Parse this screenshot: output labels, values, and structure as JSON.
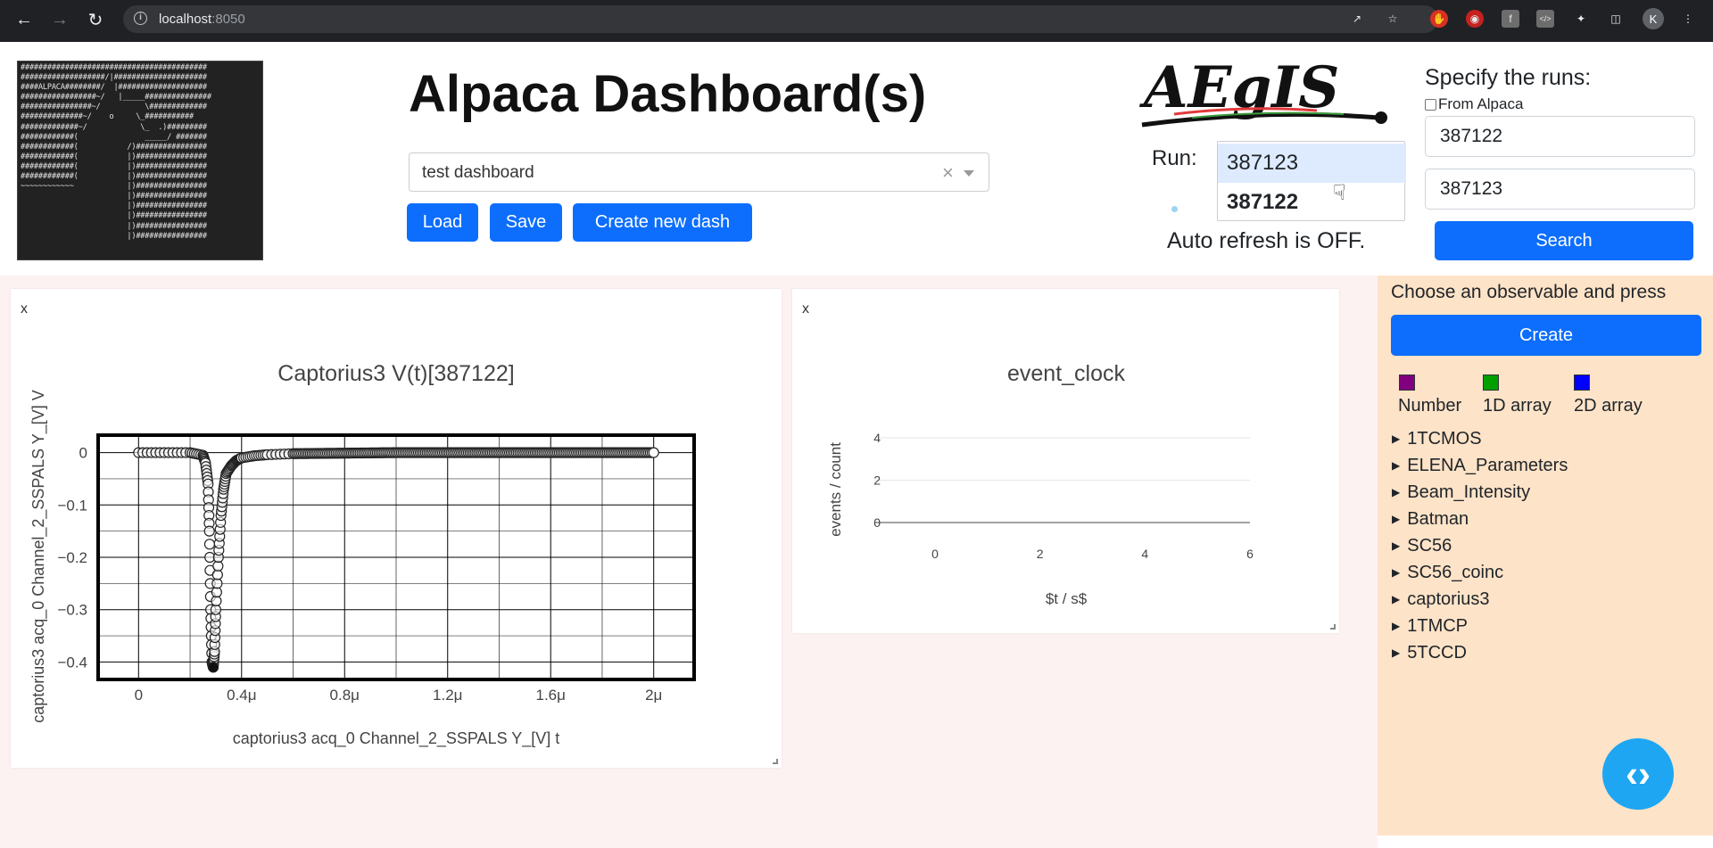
{
  "browser": {
    "url_host": "localhost",
    "url_port": ":8050",
    "avatar_letter": "K"
  },
  "header": {
    "title": "Alpaca Dashboard(s)",
    "dashboard_select_value": "test dashboard",
    "load_label": "Load",
    "save_label": "Save",
    "create_dash_label": "Create new dash",
    "logo_text": "AEgIS",
    "ascii_art": "##########################################\n###################/|#####################\n####ALPACA########/  |####################\n#################~/   |_____###############\n################~/          \\#############\n##############~/    o     \\_###########\n#############~/            \\_  .)#########\n############(               _____/ #######\n############(           /)################\n############(           |)################\n############(           |)################\n############(           |)################\n~~~~~~~~~~~~            |)################\n                        |)################\n                        |)################\n                        |)################\n                        |)################\n                        |)################"
  },
  "run": {
    "label": "Run:",
    "options": [
      "387123",
      "387122"
    ],
    "auto_refresh": "Auto refresh is OFF."
  },
  "search": {
    "specify_label": "Specify the runs:",
    "from_alpaca_label": "From Alpaca",
    "from_alpaca_checked": false,
    "run_from": "387122",
    "run_to": "387123",
    "search_label": "Search"
  },
  "panels": [
    {
      "close_label": "x",
      "title": "Captorius3 V(t)[387122]",
      "xlabel": "captorius3 acq_0 Channel_2_SSPALS Y_[V] t",
      "ylabel": "captorius3 acq_0 Channel_2_SSPALS Y_[V] V"
    },
    {
      "close_label": "x",
      "title": "event_clock",
      "xlabel": "$t /  s$",
      "ylabel": "events / count"
    }
  ],
  "chart_data": [
    {
      "type": "scatter",
      "title": "Captorius3 V(t)[387122]",
      "xlabel": "captorius3 acq_0 Channel_2_SSPALS Y_[V] t",
      "ylabel": "captorius3 acq_0 Channel_2_SSPALS Y_[V] V",
      "xticks": [
        "0",
        "0.4μ",
        "0.8μ",
        "1.2μ",
        "1.6μ",
        "2μ"
      ],
      "yticks": [
        "0",
        "−0.1",
        "−0.2",
        "−0.3",
        "−0.4"
      ],
      "xlim": [
        -1.5e-07,
        2.15e-06
      ],
      "ylim": [
        -0.43,
        0.03
      ],
      "x": [
        0,
        1e-07,
        2e-07,
        2.5e-07,
        2.6e-07,
        2.7e-07,
        2.75e-07,
        2.8e-07,
        2.85e-07,
        2.9e-07,
        2.95e-07,
        3e-07,
        3.1e-07,
        3.2e-07,
        3.3e-07,
        3.4e-07,
        3.6e-07,
        3.8e-07,
        4e-07,
        4.5e-07,
        5e-07,
        6e-07,
        8e-07,
        1e-06,
        1.2e-06,
        1.4e-06,
        1.6e-06,
        1.8e-06,
        2e-06
      ],
      "y": [
        0,
        0,
        0,
        -0.005,
        -0.02,
        -0.06,
        -0.15,
        -0.3,
        -0.4,
        -0.41,
        -0.38,
        -0.3,
        -0.2,
        -0.12,
        -0.07,
        -0.04,
        -0.025,
        -0.015,
        -0.01,
        -0.006,
        -0.004,
        -0.002,
        -0.001,
        0,
        0,
        0,
        0,
        0,
        0
      ]
    },
    {
      "type": "line",
      "title": "event_clock",
      "xlabel": "$t /  s$",
      "ylabel": "events / count",
      "xticks": [
        "0",
        "2",
        "4",
        "6"
      ],
      "yticks": [
        "0",
        "2",
        "4"
      ],
      "xlim": [
        -1,
        6
      ],
      "ylim": [
        -1,
        5
      ],
      "x": [],
      "y": []
    }
  ],
  "sidebar": {
    "choose_label": "Choose an observable and press",
    "create_label": "Create",
    "legend": [
      {
        "label": "Number",
        "color": "#800080"
      },
      {
        "label": "1D array",
        "color": "#00a000"
      },
      {
        "label": "2D array",
        "color": "#0000ff"
      }
    ],
    "tree": [
      "1TCMOS",
      "ELENA_Parameters",
      "Beam_Intensity",
      "Batman",
      "SC56",
      "SC56_coinc",
      "captorius3",
      "1TMCP",
      "5TCCD"
    ]
  },
  "colors": {
    "primary": "#0d6efd",
    "sidebar_bg": "#fde3c8",
    "content_bg": "#fdf2f2",
    "fab": "#1ea6f3"
  }
}
